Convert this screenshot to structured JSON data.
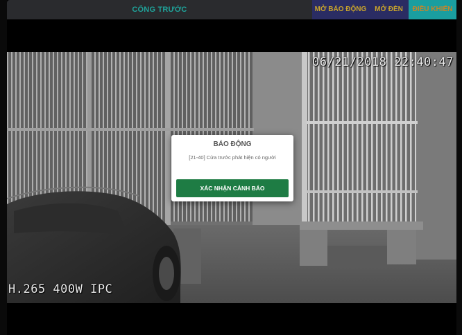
{
  "header": {
    "title": "CỔNG TRƯỚC",
    "buttons": {
      "alarm": "MỞ BÁO ĐỘNG",
      "light": "MỞ ĐÈN",
      "control": "ĐIỀU KHIỂN"
    }
  },
  "camera": {
    "timestamp": "06/21/2018 22:40:47",
    "codec_label": "H.265 400W IPC"
  },
  "alert": {
    "title": "BÁO ĐỘNG",
    "message": "[21-40] Cửa trước phát hiện có người",
    "confirm_label": "XÁC NHẬN CẢNH BÁO"
  },
  "colors": {
    "title": "#1fa39a",
    "alarm_button_bg": "#2a2c63",
    "button_text": "#c9a42c",
    "control_button_bg": "#1a9ea0",
    "confirm_button_bg": "#1e7c44"
  }
}
